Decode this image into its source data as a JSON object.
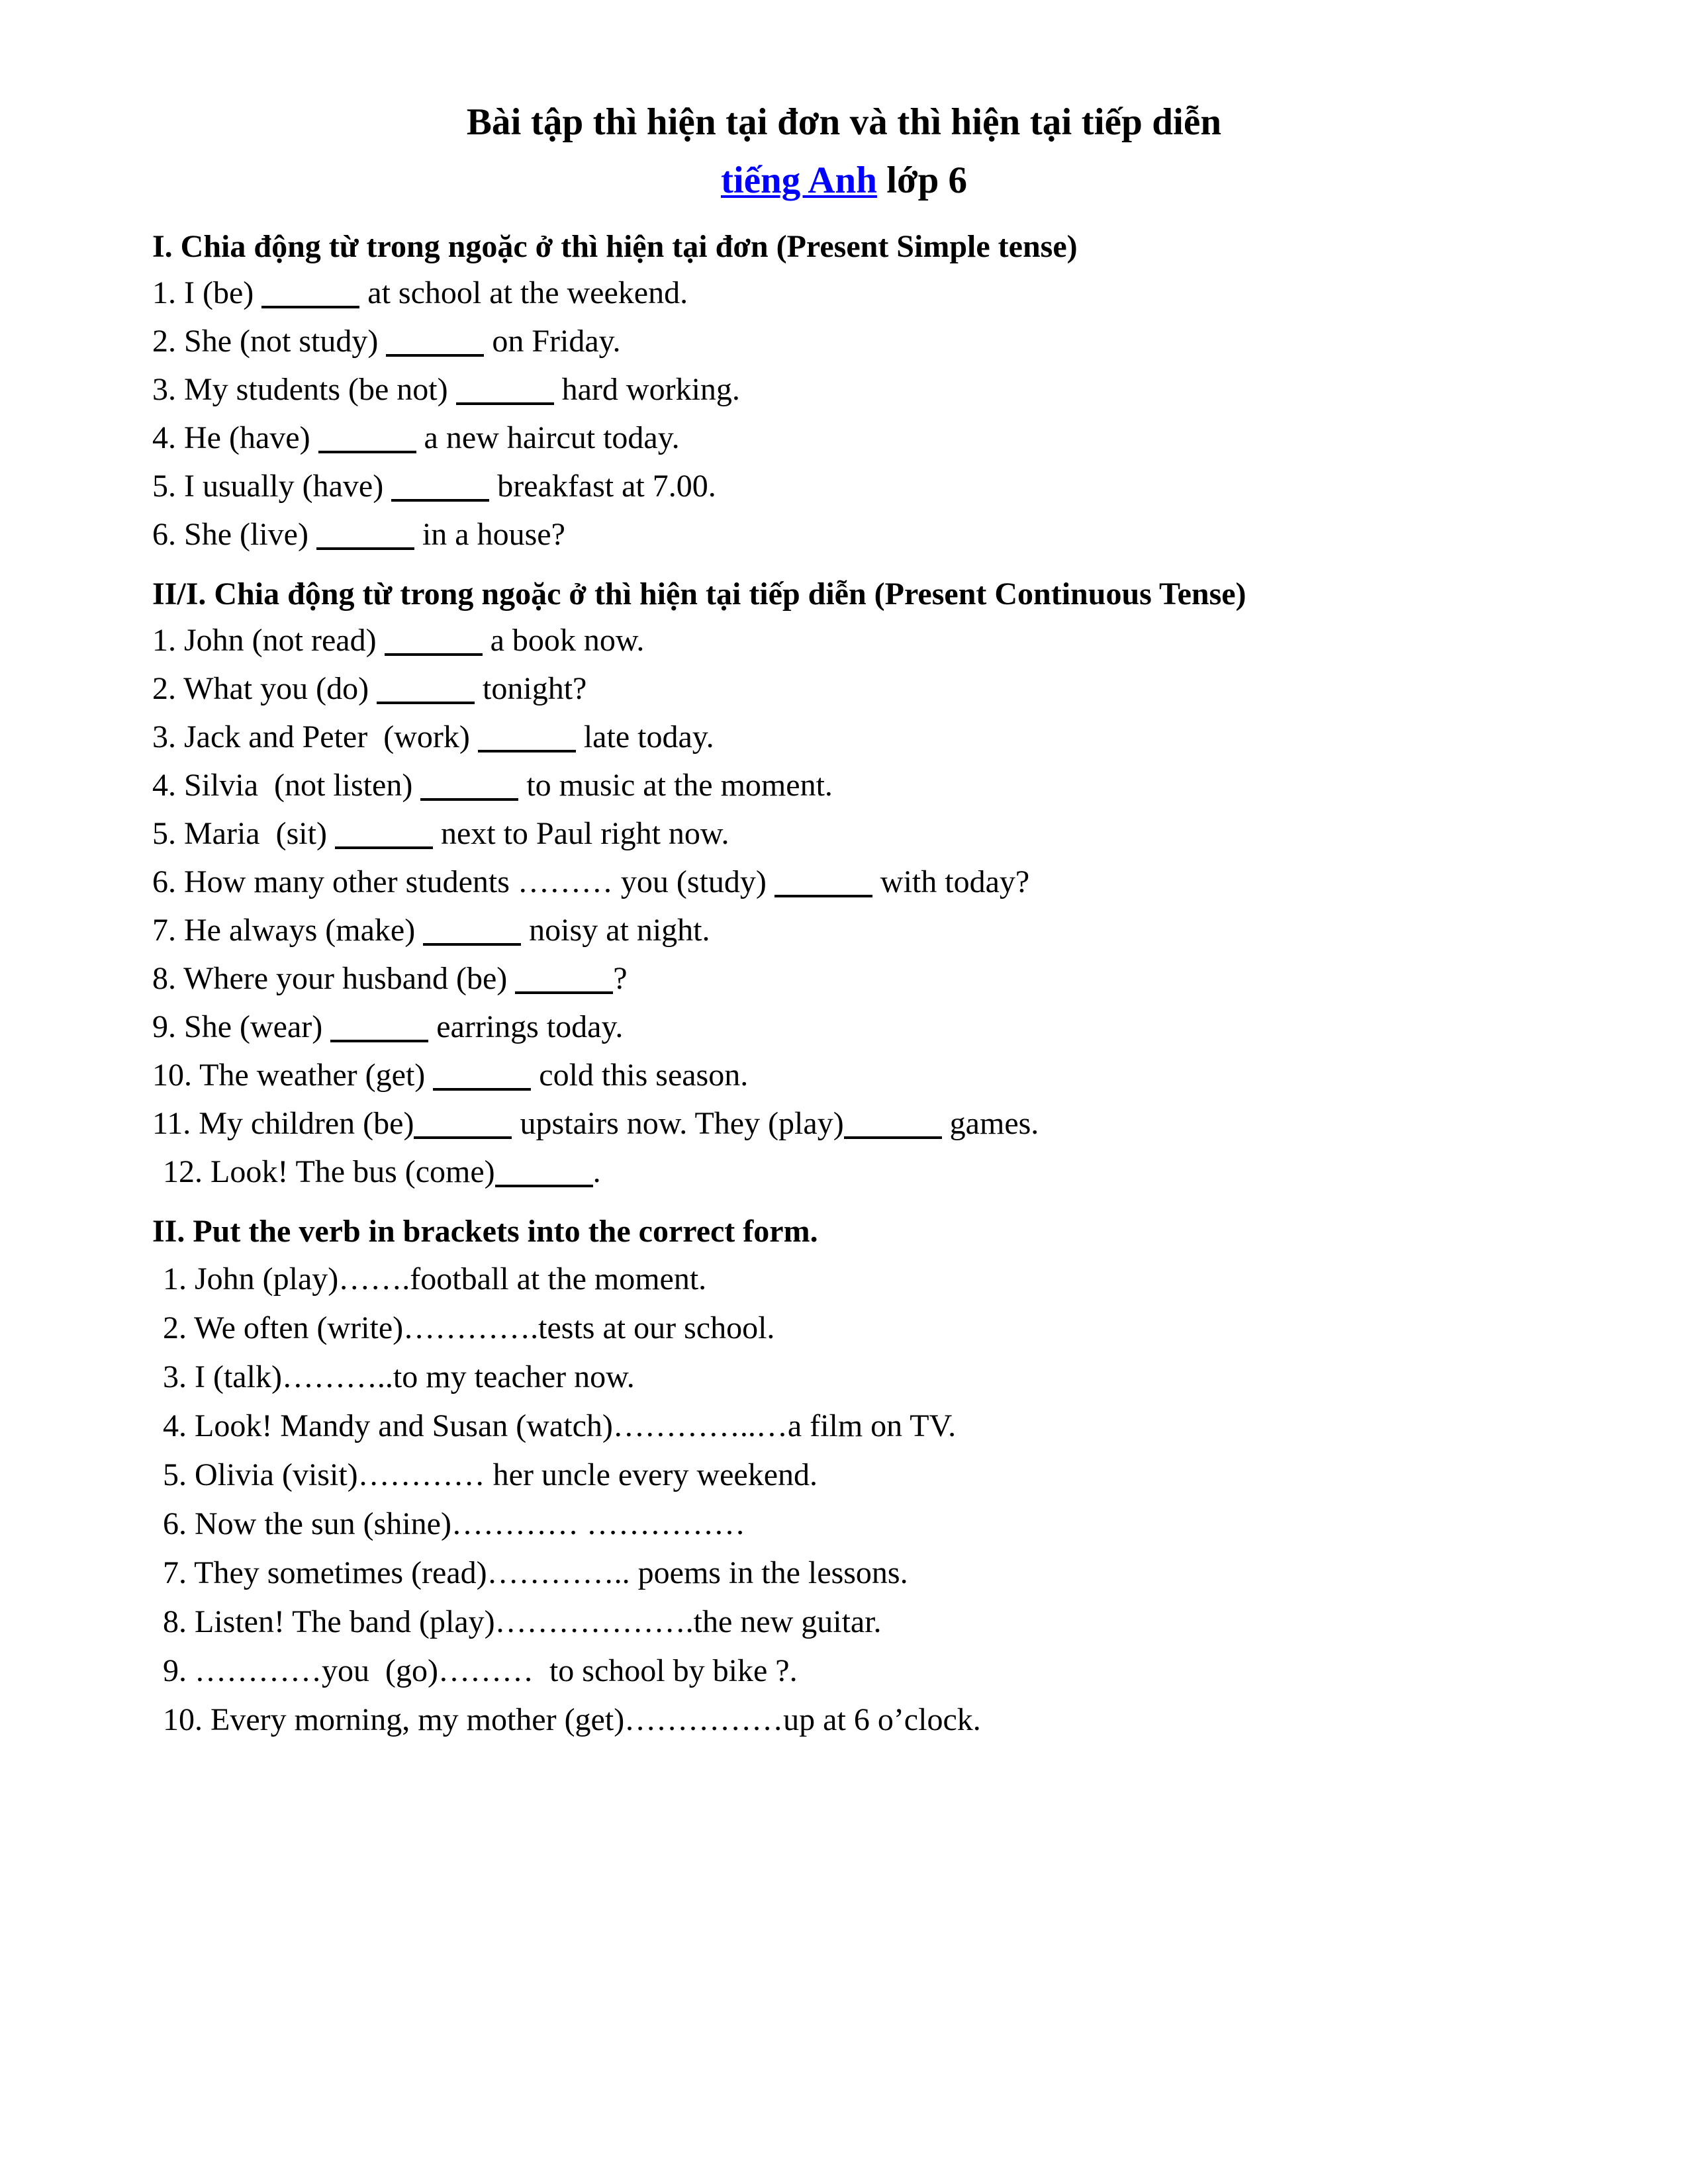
{
  "document": {
    "title_line1": "Bài tập thì hiện tại đơn và thì hiện tại tiếp diễn",
    "subtitle_link": "tiếng Anh",
    "subtitle_rest": " lớp 6",
    "link_color": "#0000ff",
    "text_color": "#000000",
    "background_color": "#ffffff"
  },
  "sections": [
    {
      "id": "section-1",
      "heading": "I. Chia động từ trong ngoặc ở thì hiện tại đơn (Present Simple tense)",
      "style": "blanks",
      "items": [
        {
          "num": "1.",
          "before": " I (be) ",
          "after": " at school at the weekend."
        },
        {
          "num": "2.",
          "before": " She (not study) ",
          "after": " on Friday."
        },
        {
          "num": "3.",
          "before": " My students (be not) ",
          "after": " hard working."
        },
        {
          "num": "4.",
          "before": " He (have) ",
          "after": " a new haircut today."
        },
        {
          "num": "5.",
          "before": " I usually (have) ",
          "after": " breakfast at 7.00."
        },
        {
          "num": "6.",
          "before": " She (live) ",
          "after": " in a house?"
        }
      ]
    },
    {
      "id": "section-2",
      "heading": "II/I. Chia động từ trong ngoặc ở thì hiện tại tiếp diễn (Present Continuous Tense)",
      "style": "blanks",
      "items": [
        {
          "num": "1.",
          "before": " John (not read) ",
          "after": " a book now."
        },
        {
          "num": "2.",
          "before": " What you (do) ",
          "after": " tonight?"
        },
        {
          "num": "3.",
          "before": " Jack and Peter  (work) ",
          "after": " late today."
        },
        {
          "num": "4.",
          "before": " Silvia  (not listen) ",
          "after": " to music at the moment."
        },
        {
          "num": "5.",
          "before": " Maria  (sit) ",
          "after": " next to Paul right now."
        },
        {
          "num": "6.",
          "before": " How many other students ……… you (study) ",
          "after": " with today?"
        },
        {
          "num": "7.",
          "before": " He always (make) ",
          "after": " noisy at night."
        },
        {
          "num": "8.",
          "before": " Where your husband (be) ",
          "after": "?"
        },
        {
          "num": "9.",
          "before": " She (wear) ",
          "after": " earrings today."
        },
        {
          "num": "10.",
          "before": " The weather (get) ",
          "after": " cold this season."
        },
        {
          "num": "11.",
          "before": " My children (be)",
          "after": " upstairs now. They (play)",
          "after2": " games.",
          "two_blanks": true
        },
        {
          "num": "12.",
          "before": " Look! The bus (come)",
          "after": ".",
          "indented": true
        }
      ]
    },
    {
      "id": "section-3",
      "heading": "II. Put the verb in brackets into the correct form.",
      "style": "dots",
      "items": [
        {
          "num": "1.",
          "text": "1. John (play)…….football at the moment."
        },
        {
          "num": "2.",
          "text": "2. We often (write)………….tests at our school."
        },
        {
          "num": "3.",
          "text": "3. I (talk)………..to my teacher now."
        },
        {
          "num": "4.",
          "text": "4. Look! Mandy and Susan (watch)…………..…a film on TV."
        },
        {
          "num": "5.",
          "text": "5. Olivia (visit)………… her uncle every weekend."
        },
        {
          "num": "6.",
          "text": "6. Now the sun (shine)………… ……………"
        },
        {
          "num": "7.",
          "text": "7. They sometimes (read)………….. poems in the lessons."
        },
        {
          "num": "8.",
          "text": "8. Listen! The band (play)……………….the new guitar."
        },
        {
          "num": "9.",
          "text": "9. …………you  (go)………  to school by bike ?."
        },
        {
          "num": "10.",
          "text": "10. Every morning, my mother (get)……………up at 6 o’clock."
        }
      ]
    }
  ]
}
